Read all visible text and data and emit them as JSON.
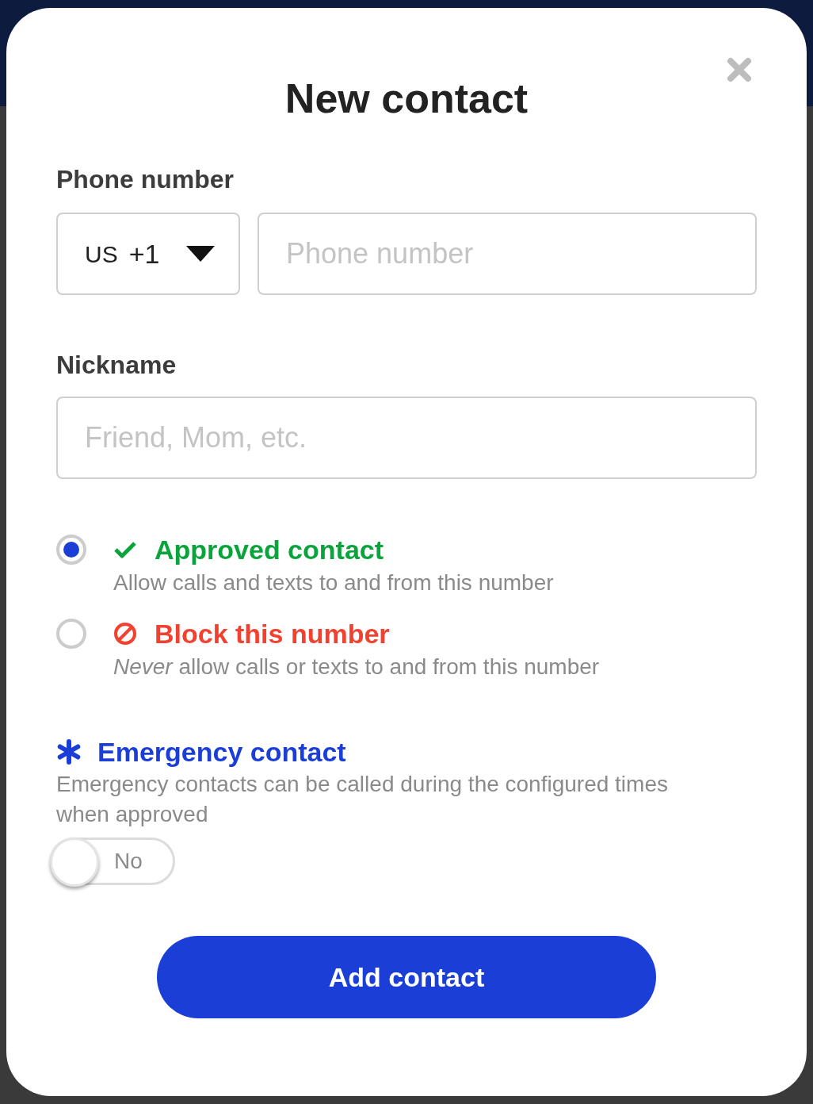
{
  "dialog": {
    "title": "New contact"
  },
  "phone": {
    "label": "Phone number",
    "country": "US",
    "code": "+1",
    "placeholder": "Phone number"
  },
  "nickname": {
    "label": "Nickname",
    "placeholder": "Friend, Mom, etc."
  },
  "options": [
    {
      "kind": "approve",
      "label": "Approved contact",
      "description": "Allow calls and texts to and from this number",
      "selected": true
    },
    {
      "kind": "block",
      "label": "Block this number",
      "description": "*Never* allow calls or texts to and from this number",
      "selected": false
    }
  ],
  "emergency": {
    "label": "Emergency contact",
    "description": "Emergency contacts can be called during the configured times when approved",
    "on": false,
    "state_label": "No"
  },
  "submit": "Add contact"
}
